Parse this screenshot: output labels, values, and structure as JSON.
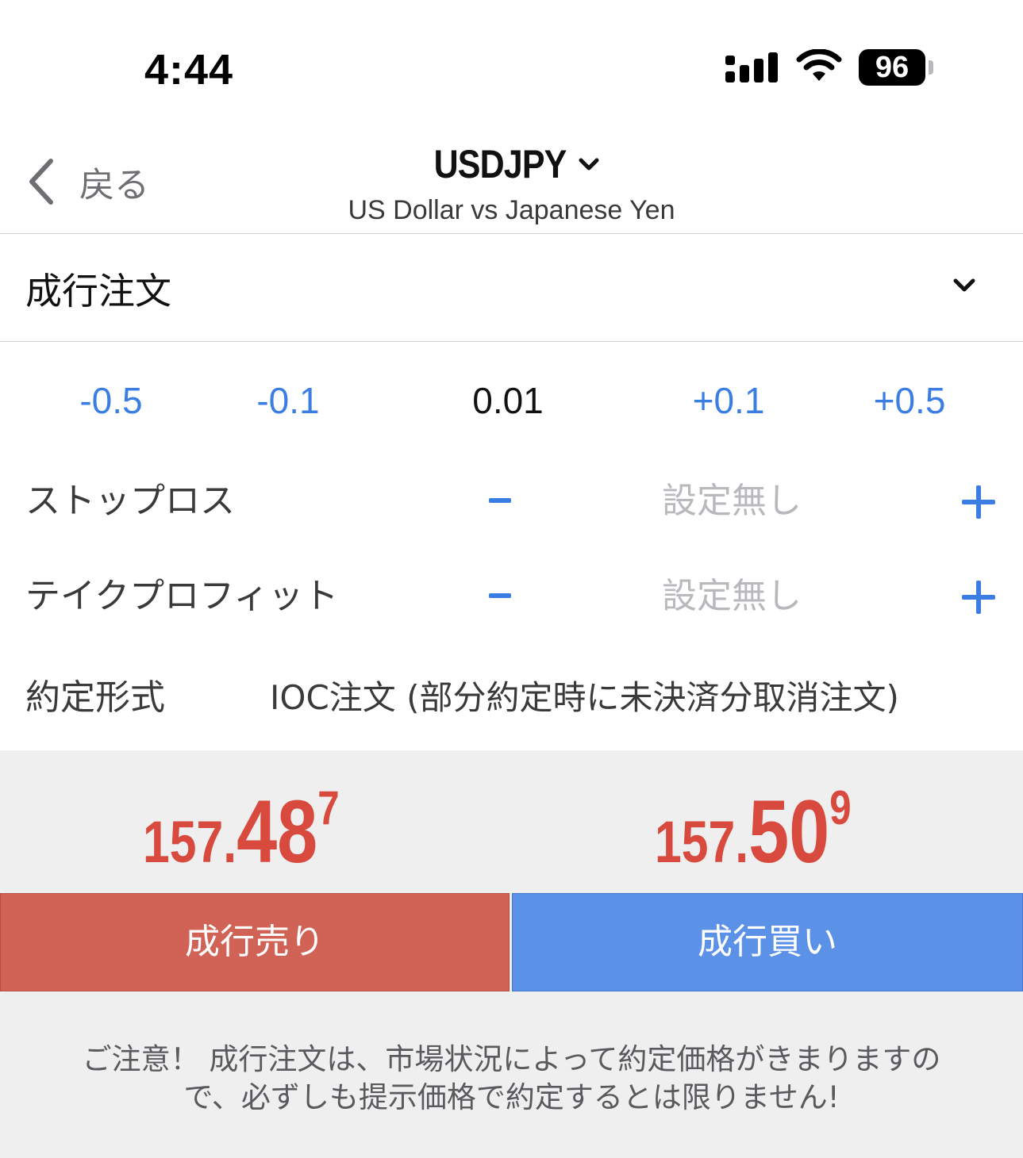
{
  "status_bar": {
    "time": "4:44",
    "battery": "96",
    "icons": [
      "signal-icon",
      "wifi-icon",
      "battery-icon"
    ]
  },
  "header": {
    "back_label": "戻る",
    "symbol": "USDJPY",
    "description": "US Dollar vs Japanese Yen"
  },
  "order_type": {
    "label": "成行注文"
  },
  "volume": {
    "minus_large": "-0.5",
    "minus_small": "-0.1",
    "value": "0.01",
    "plus_small": "+0.1",
    "plus_large": "+0.5"
  },
  "stop_loss": {
    "label": "ストップロス",
    "value": "設定無し"
  },
  "take_profit": {
    "label": "テイクプロフィット",
    "value": "設定無し"
  },
  "fill_policy": {
    "label": "約定形式",
    "value": "IOC注文 (部分約定時に未決済分取消注文)"
  },
  "prices": {
    "bid": {
      "main": "157.",
      "big": "48",
      "pip": "7"
    },
    "ask": {
      "main": "157.",
      "big": "50",
      "pip": "9"
    }
  },
  "actions": {
    "sell_label": "成行売り",
    "buy_label": "成行買い"
  },
  "warning": {
    "line1": "ご注意！ 成行注文は、市場状況によって約定価格がきまりますの",
    "line2": "で、必ずしも提示価格で約定するとは限りません!"
  },
  "colors": {
    "accent_blue": "#3a7ee4",
    "price_red": "#d94a3e",
    "sell_button": "#d06355",
    "buy_button": "#5b92e8",
    "panel_bg": "#efeff0"
  }
}
